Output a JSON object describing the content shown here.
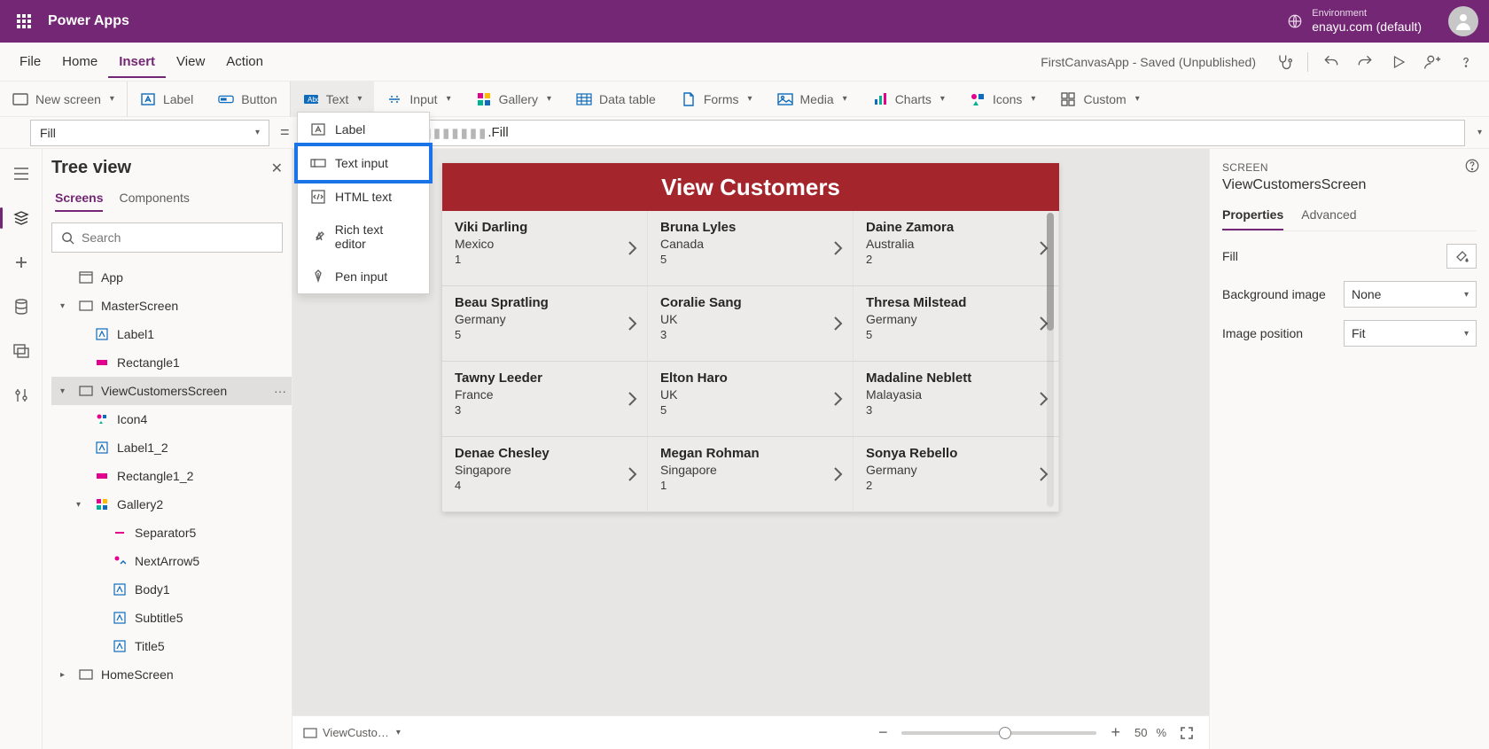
{
  "topbar": {
    "title": "Power Apps",
    "env_label": "Environment",
    "env_name": "enayu.com (default)"
  },
  "menubar": {
    "items": [
      "File",
      "Home",
      "Insert",
      "View",
      "Action"
    ],
    "active_index": 2,
    "app_status": "FirstCanvasApp - Saved (Unpublished)"
  },
  "ribbon": {
    "new_screen": "New screen",
    "label": "Label",
    "button": "Button",
    "text": "Text",
    "input": "Input",
    "gallery": "Gallery",
    "data_table": "Data table",
    "forms": "Forms",
    "media": "Media",
    "charts": "Charts",
    "icons": "Icons",
    "custom": "Custom"
  },
  "text_dropdown": {
    "items": [
      "Label",
      "Text input",
      "HTML text",
      "Rich text editor",
      "Pen input"
    ],
    "highlighted_index": 1
  },
  "formula": {
    "property": "Fill",
    "value_suffix": ".Fill"
  },
  "tree": {
    "title": "Tree view",
    "tabs": [
      "Screens",
      "Components"
    ],
    "active_tab": 0,
    "search_placeholder": "Search",
    "nodes": [
      {
        "indent": 0,
        "exp": "",
        "icon": "app",
        "label": "App"
      },
      {
        "indent": 0,
        "exp": "▾",
        "icon": "screen",
        "label": "MasterScreen"
      },
      {
        "indent": 1,
        "exp": "",
        "icon": "label",
        "label": "Label1"
      },
      {
        "indent": 1,
        "exp": "",
        "icon": "rect",
        "label": "Rectangle1"
      },
      {
        "indent": 0,
        "exp": "▾",
        "icon": "screen",
        "label": "ViewCustomersScreen",
        "selected": true,
        "more": true
      },
      {
        "indent": 1,
        "exp": "",
        "icon": "icon",
        "label": "Icon4"
      },
      {
        "indent": 1,
        "exp": "",
        "icon": "label",
        "label": "Label1_2"
      },
      {
        "indent": 1,
        "exp": "",
        "icon": "rect",
        "label": "Rectangle1_2"
      },
      {
        "indent": 1,
        "exp": "▾",
        "icon": "gallery",
        "label": "Gallery2"
      },
      {
        "indent": 2,
        "exp": "",
        "icon": "sep",
        "label": "Separator5"
      },
      {
        "indent": 2,
        "exp": "",
        "icon": "arrow",
        "label": "NextArrow5"
      },
      {
        "indent": 2,
        "exp": "",
        "icon": "label",
        "label": "Body1"
      },
      {
        "indent": 2,
        "exp": "",
        "icon": "label",
        "label": "Subtitle5"
      },
      {
        "indent": 2,
        "exp": "",
        "icon": "label",
        "label": "Title5"
      },
      {
        "indent": 0,
        "exp": "▸",
        "icon": "screen",
        "label": "HomeScreen"
      }
    ]
  },
  "canvas": {
    "header": "View Customers",
    "rows": [
      [
        {
          "name": "Viki Darling",
          "country": "Mexico",
          "num": "1"
        },
        {
          "name": "Bruna Lyles",
          "country": "Canada",
          "num": "5"
        },
        {
          "name": "Daine Zamora",
          "country": "Australia",
          "num": "2"
        }
      ],
      [
        {
          "name": "Beau Spratling",
          "country": "Germany",
          "num": "5"
        },
        {
          "name": "Coralie Sang",
          "country": "UK",
          "num": "3"
        },
        {
          "name": "Thresa Milstead",
          "country": "Germany",
          "num": "5"
        }
      ],
      [
        {
          "name": "Tawny Leeder",
          "country": "France",
          "num": "3"
        },
        {
          "name": "Elton Haro",
          "country": "UK",
          "num": "5"
        },
        {
          "name": "Madaline Neblett",
          "country": "Malayasia",
          "num": "3"
        }
      ],
      [
        {
          "name": "Denae Chesley",
          "country": "Singapore",
          "num": "4"
        },
        {
          "name": "Megan Rohman",
          "country": "Singapore",
          "num": "1"
        },
        {
          "name": "Sonya Rebello",
          "country": "Germany",
          "num": "2"
        }
      ]
    ]
  },
  "canvas_footer": {
    "selector": "ViewCusto…",
    "zoom_label": "%",
    "zoom_value": "50"
  },
  "right_panel": {
    "heading": "SCREEN",
    "name": "ViewCustomersScreen",
    "tabs": [
      "Properties",
      "Advanced"
    ],
    "active_tab": 0,
    "fill_label": "Fill",
    "bg_image_label": "Background image",
    "bg_image_value": "None",
    "img_pos_label": "Image position",
    "img_pos_value": "Fit"
  }
}
